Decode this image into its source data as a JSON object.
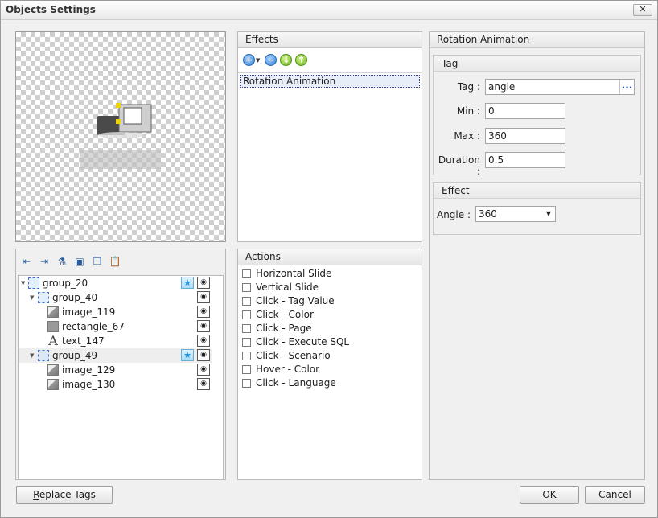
{
  "window": {
    "title": "Objects Settings",
    "close_glyph": "✕"
  },
  "effects": {
    "header": "Effects",
    "toolbar": [
      {
        "icon": "add-icon",
        "glyph": "+"
      },
      {
        "icon": "remove-icon",
        "glyph": "−"
      },
      {
        "icon": "move-down-icon",
        "glyph": "↓"
      },
      {
        "icon": "move-up-icon",
        "glyph": "↑"
      }
    ],
    "items": [
      "Rotation Animation"
    ]
  },
  "actions": {
    "header": "Actions",
    "items": [
      "Horizontal Slide",
      "Vertical Slide",
      "Click - Tag Value",
      "Click - Color",
      "Click - Page",
      "Click - Execute SQL",
      "Click - Scenario",
      "Hover - Color",
      "Click - Language"
    ]
  },
  "tree": {
    "toolbar_icons": [
      "indent-left-icon",
      "indent-right-icon",
      "filter-icon",
      "select-all-icon",
      "copy-icon",
      "paste-icon"
    ],
    "nodes": [
      {
        "label": "group_20",
        "type": "group",
        "level": 0,
        "expanded": true,
        "star": true
      },
      {
        "label": "group_40",
        "type": "group",
        "level": 1,
        "expanded": true,
        "star": false
      },
      {
        "label": "image_119",
        "type": "image",
        "level": 2,
        "star": false
      },
      {
        "label": "rectangle_67",
        "type": "rectangle",
        "level": 2,
        "star": false
      },
      {
        "label": "text_147",
        "type": "text",
        "level": 2,
        "star": false
      },
      {
        "label": "group_49",
        "type": "group",
        "level": 1,
        "expanded": true,
        "star": true
      },
      {
        "label": "image_129",
        "type": "image",
        "level": 2,
        "star": false
      },
      {
        "label": "image_130",
        "type": "image",
        "level": 2,
        "star": false
      }
    ]
  },
  "properties": {
    "header": "Rotation Animation",
    "tag_group": {
      "header": "Tag",
      "tag_label": "Tag :",
      "tag_value": "angle",
      "min_label": "Min :",
      "min_value": "0",
      "max_label": "Max :",
      "max_value": "360",
      "duration_label": "Duration :",
      "duration_value": "0.5",
      "browse_glyph": "..."
    },
    "effect_group": {
      "header": "Effect",
      "angle_label": "Angle :",
      "angle_value": "360"
    }
  },
  "buttons": {
    "replace_tags": "Replace Tags",
    "replace_tags_mnemonic": "R",
    "replace_tags_rest": "eplace Tags",
    "ok": "OK",
    "cancel": "Cancel"
  }
}
